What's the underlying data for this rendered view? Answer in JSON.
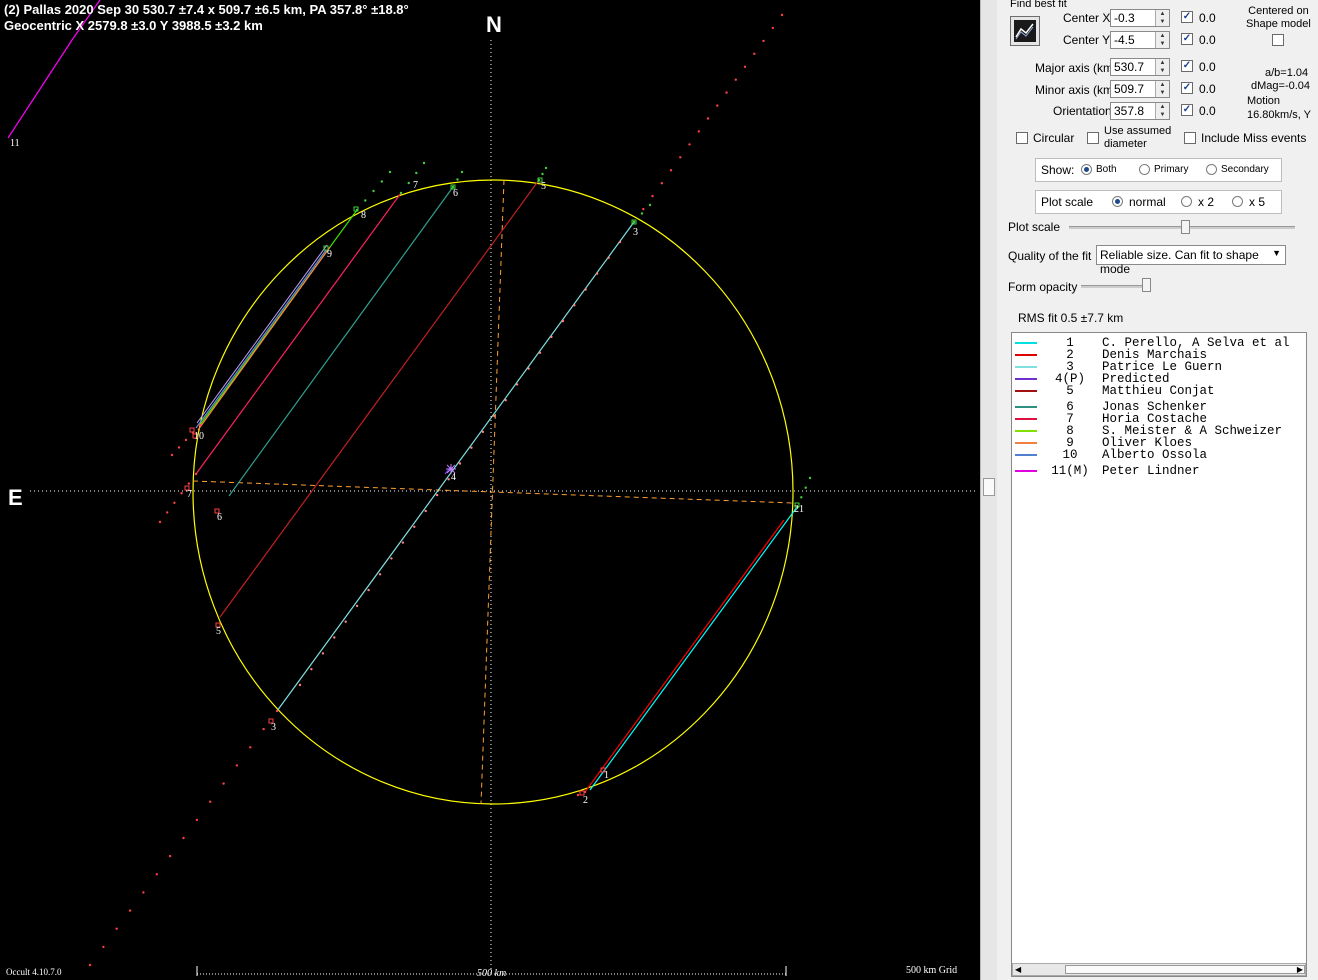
{
  "header": {
    "line1": "(2) Pallas  2020 Sep 30   530.7 ±7.4 x 509.7 ±6.5 km,  PA 357.8° ±18.8°",
    "line2": "Geocentric  X  2579.8 ±3.0  Y 3988.5 ±3.2 km"
  },
  "compass": {
    "north": "N",
    "east": "E"
  },
  "footer": {
    "version": "Occult 4.10.7.0",
    "scale_label": "500 km",
    "grid_label": "500 km Grid"
  },
  "plot_colors": {
    "ellipse": "#ffff00",
    "axes": "#ffa030",
    "disappear": "#ff4040",
    "reappear": "#40d040"
  },
  "chords": [
    {
      "id": "1",
      "color": "#00ffff"
    },
    {
      "id": "2",
      "color": "#ff0000"
    },
    {
      "id": "3",
      "color": "#80e0e0"
    },
    {
      "id": "4",
      "color": "#8040ff"
    },
    {
      "id": "5",
      "color": "#c02020"
    },
    {
      "id": "6",
      "color": "#2fa090"
    },
    {
      "id": "7",
      "color": "#ff2060"
    },
    {
      "id": "8",
      "color": "#40e000"
    },
    {
      "id": "9",
      "color": "#ff8040"
    },
    {
      "id": "10",
      "color": "#6090e0"
    },
    {
      "id": "11",
      "color": "#ff00ff"
    }
  ],
  "chord_labels": [
    "1",
    "2",
    "3",
    "3",
    "5",
    "5",
    "6",
    "6",
    "7",
    "7",
    "8",
    "9",
    "10",
    "11",
    "4",
    "21"
  ],
  "panel": {
    "find_best_fit": "Find best fit",
    "centered_on_shape": "Centered on\nShape model",
    "center_x_label": "Center X",
    "center_x": "-0.3",
    "center_x_step": "0.0",
    "center_y_label": "Center Y",
    "center_y": "-4.5",
    "center_y_step": "0.0",
    "major_label": "Major axis (km)",
    "major": "530.7",
    "major_step": "0.0",
    "minor_label": "Minor axis (km)",
    "minor": "509.7",
    "minor_step": "0.0",
    "orient_label": "Orientation",
    "orient": "357.8",
    "orient_step": "0.0",
    "ab": "a/b=1.04",
    "dmag": "dMag=-0.04",
    "motion_label": "Motion",
    "motion": "16.80km/s, Y",
    "circular": "Circular",
    "use_assumed": "Use assumed\ndiameter",
    "include_miss": "Include Miss events",
    "show_label": "Show:",
    "show_both": "Both",
    "show_primary": "Primary",
    "show_secondary": "Secondary",
    "plot_scale_label": "Plot scale",
    "scale_normal": "normal",
    "scale_x2": "x 2",
    "scale_x5": "x 5",
    "plot_scale_slider": "Plot scale",
    "quality_label": "Quality of the fit",
    "quality_value": "Reliable size. Can fit to shape mode",
    "form_opacity": "Form opacity",
    "rms": "RMS fit 0.5 ±7.7 km"
  },
  "legend": [
    {
      "num": "1",
      "name": "C. Perello, A Selva et al",
      "color": "#00e0e0"
    },
    {
      "num": "2",
      "name": "Denis Marchais",
      "color": "#e00000"
    },
    {
      "num": "3",
      "name": "Patrice Le Guern",
      "color": "#80e0e0"
    },
    {
      "num": "4(P)",
      "name": "Predicted",
      "color": "#7030d0"
    },
    {
      "num": "5",
      "name": "Matthieu Conjat",
      "color": "#a01010"
    },
    {
      "num": "6",
      "name": "Jonas Schenker",
      "color": "#2f8f80"
    },
    {
      "num": "7",
      "name": "Horia Costache",
      "color": "#e01040"
    },
    {
      "num": "8",
      "name": "S. Meister & A Schweizer",
      "color": "#80e000"
    },
    {
      "num": "9",
      "name": "Oliver Kloes",
      "color": "#f08040"
    },
    {
      "num": "10",
      "name": "Alberto Ossola",
      "color": "#5080d0"
    },
    {
      "num": "11(M)",
      "name": "Peter Lindner",
      "color": "#e000e0"
    }
  ]
}
